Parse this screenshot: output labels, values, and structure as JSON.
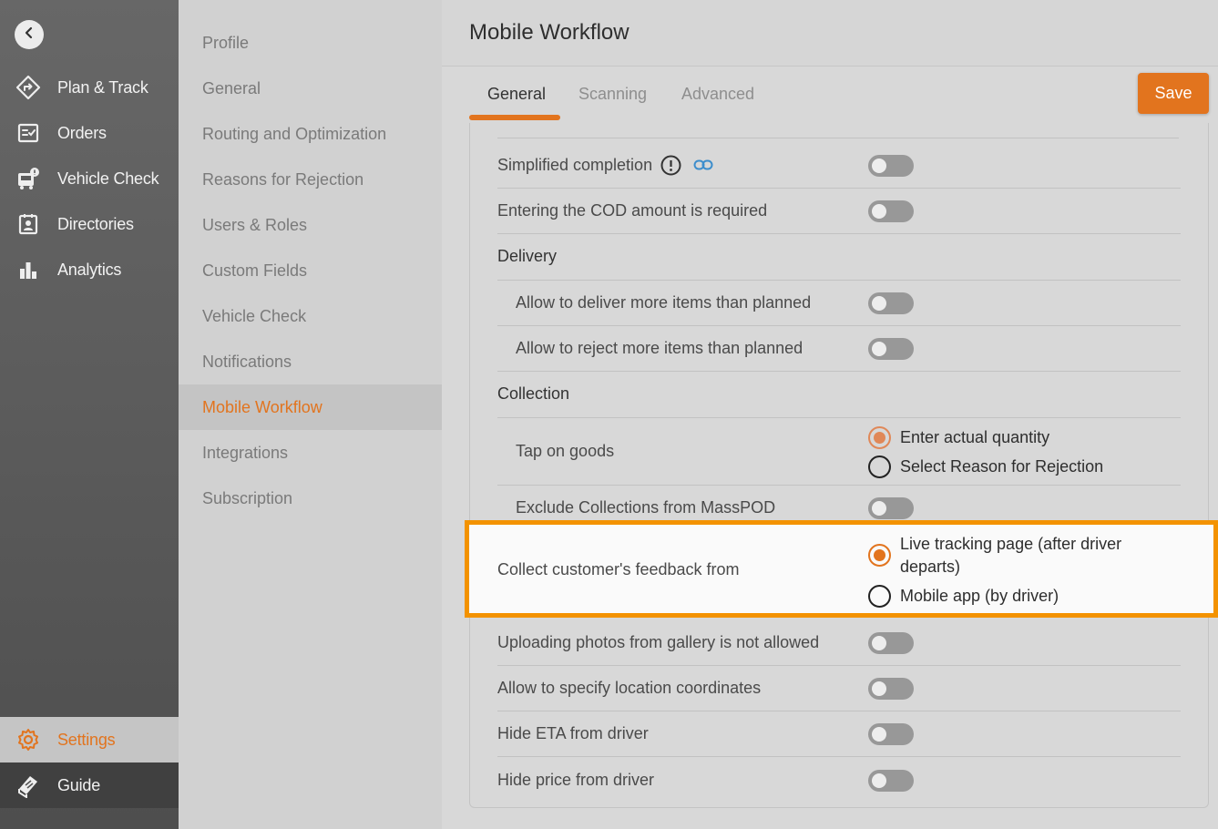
{
  "nav": {
    "back": "back-arrow-icon",
    "items": [
      {
        "label": "Plan & Track",
        "icon": "route-icon"
      },
      {
        "label": "Orders",
        "icon": "orders-icon"
      },
      {
        "label": "Vehicle Check",
        "icon": "vehicle-check-icon"
      },
      {
        "label": "Directories",
        "icon": "directories-icon"
      },
      {
        "label": "Analytics",
        "icon": "analytics-icon"
      }
    ],
    "settings": {
      "label": "Settings",
      "icon": "gear-icon"
    },
    "guide": {
      "label": "Guide",
      "icon": "guide-icon"
    }
  },
  "submenu": {
    "items": [
      "Profile",
      "General",
      "Routing and Optimization",
      "Reasons for Rejection",
      "Users & Roles",
      "Custom Fields",
      "Vehicle Check",
      "Notifications",
      "Mobile Workflow",
      "Integrations",
      "Subscription"
    ],
    "active": "Mobile Workflow"
  },
  "header": {
    "title": "Mobile Workflow"
  },
  "tabs": [
    {
      "label": "General",
      "active": true
    },
    {
      "label": "Scanning",
      "active": false
    },
    {
      "label": "Advanced",
      "active": false
    }
  ],
  "save_label": "Save",
  "settings": {
    "simplified_completion": {
      "label": "Simplified completion",
      "enabled": false
    },
    "cod_required": {
      "label": "Entering the COD amount is required",
      "enabled": false
    },
    "delivery_section": "Delivery",
    "deliver_more": {
      "label": "Allow to deliver more items than planned",
      "enabled": false
    },
    "reject_more": {
      "label": "Allow to reject more items than planned",
      "enabled": false
    },
    "collection_section": "Collection",
    "tap_on_goods": {
      "label": "Tap on goods",
      "options": [
        "Enter actual quantity",
        "Select Reason for Rejection"
      ],
      "selected": "Enter actual quantity"
    },
    "exclude_masspod": {
      "label": "Exclude Collections from MassPOD",
      "enabled": false
    },
    "feedback": {
      "label": "Collect customer's feedback from",
      "options": [
        "Live tracking page (after driver",
        "departs)",
        "Mobile app (by driver)"
      ],
      "selected": "Live tracking page (after driver departs)"
    },
    "gallery_photos": {
      "label": "Uploading photos from gallery is not allowed",
      "enabled": false
    },
    "location_coords": {
      "label": "Allow to specify location coordinates",
      "enabled": false
    },
    "hide_eta": {
      "label": "Hide ETA from driver",
      "enabled": false
    },
    "hide_price": {
      "label": "Hide price from driver",
      "enabled": false
    }
  },
  "colors": {
    "accent": "#e2741e",
    "highlight_border": "#f39200"
  }
}
